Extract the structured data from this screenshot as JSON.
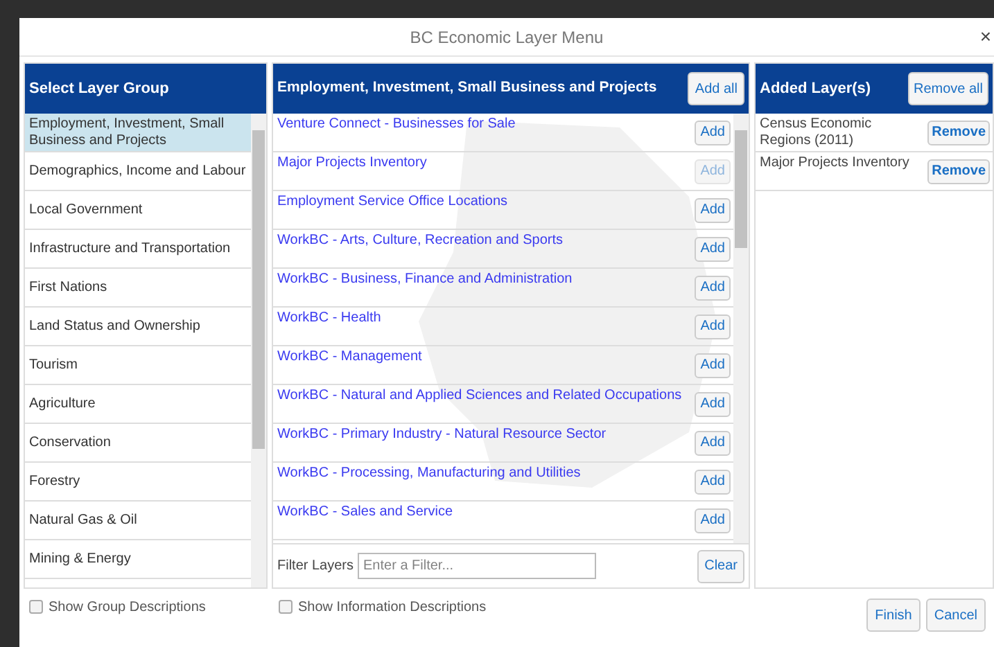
{
  "window": {
    "title": "BC Economic Layer Menu",
    "close": "×"
  },
  "groups_panel": {
    "title": "Select Layer Group",
    "items": [
      {
        "label": "Employment, Investment, Small Business and Projects",
        "selected": true
      },
      {
        "label": "Demographics, Income and Labour",
        "selected": false
      },
      {
        "label": "Local Government",
        "selected": false
      },
      {
        "label": "Infrastructure and Transportation",
        "selected": false
      },
      {
        "label": "First Nations",
        "selected": false
      },
      {
        "label": "Land Status and Ownership",
        "selected": false
      },
      {
        "label": "Tourism",
        "selected": false
      },
      {
        "label": "Agriculture",
        "selected": false
      },
      {
        "label": "Conservation",
        "selected": false
      },
      {
        "label": "Forestry",
        "selected": false
      },
      {
        "label": "Natural Gas & Oil",
        "selected": false
      },
      {
        "label": "Mining & Energy",
        "selected": false
      }
    ],
    "show_descriptions": {
      "label": "Show Group Descriptions",
      "checked": false
    }
  },
  "layers_panel": {
    "title": "Employment, Investment, Small Business and Projects",
    "add_all": "Add all",
    "layers": [
      {
        "label": "Venture Connect - Businesses for Sale",
        "button": "Add",
        "disabled": false
      },
      {
        "label": "Major Projects Inventory",
        "button": "Add",
        "disabled": true
      },
      {
        "label": "Employment Service Office Locations",
        "button": "Add",
        "disabled": false
      },
      {
        "label": "WorkBC - Arts, Culture, Recreation and Sports",
        "button": "Add",
        "disabled": false
      },
      {
        "label": "WorkBC - Business, Finance and Administration",
        "button": "Add",
        "disabled": false
      },
      {
        "label": "WorkBC - Health",
        "button": "Add",
        "disabled": false
      },
      {
        "label": "WorkBC - Management",
        "button": "Add",
        "disabled": false
      },
      {
        "label": "WorkBC - Natural and Applied Sciences and Related Occupations",
        "button": "Add",
        "disabled": false
      },
      {
        "label": "WorkBC - Primary Industry - Natural Resource Sector",
        "button": "Add",
        "disabled": false
      },
      {
        "label": "WorkBC - Processing, Manufacturing and Utilities",
        "button": "Add",
        "disabled": false
      },
      {
        "label": "WorkBC - Sales and Service",
        "button": "Add",
        "disabled": false
      }
    ],
    "filter": {
      "label": "Filter Layers",
      "placeholder": "Enter a Filter...",
      "clear": "Clear"
    },
    "show_descriptions": {
      "label": "Show Information Descriptions",
      "checked": false
    }
  },
  "added_panel": {
    "title": "Added Layer(s)",
    "remove_all": "Remove all",
    "layers": [
      {
        "label": "Census Economic Regions (2011)",
        "button": "Remove"
      },
      {
        "label": "Major Projects Inventory",
        "button": "Remove"
      }
    ]
  },
  "buttons": [
    "Finish",
    "Cancel"
  ]
}
